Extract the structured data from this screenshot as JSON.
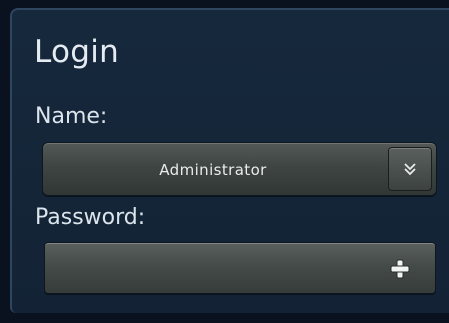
{
  "login": {
    "title": "Login",
    "name_label": "Name:",
    "name_value": "Administrator",
    "password_label": "Password:",
    "dropdown_icon": "double-chevron-down-icon",
    "password_action_icon": "plus-icon"
  }
}
